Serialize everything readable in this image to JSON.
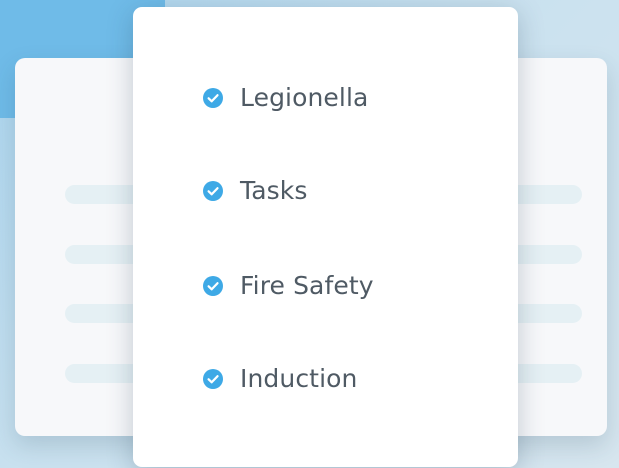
{
  "checklist": {
    "items": [
      {
        "label": "Legionella",
        "icon": "check-circle-icon"
      },
      {
        "label": "Tasks",
        "icon": "check-circle-icon"
      },
      {
        "label": "Fire Safety",
        "icon": "check-circle-icon"
      },
      {
        "label": "Induction",
        "icon": "check-circle-icon"
      }
    ]
  },
  "colors": {
    "accent": "#3ea9e6",
    "text": "#4f5a64",
    "background": "#c9e1ef",
    "skeleton": "#e5f0f4"
  }
}
